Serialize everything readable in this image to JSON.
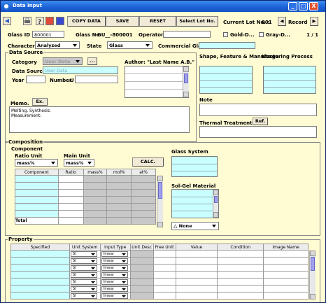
{
  "window": {
    "title": "Data Input",
    "min": "_",
    "max": "□",
    "close": "X"
  },
  "toolbar": {
    "icons": [
      "back-icon",
      "print-icon",
      "help-icon",
      "export-icon",
      "import-icon"
    ],
    "copy_data": "COPY DATA",
    "save": "SAVE",
    "reset": "RESET",
    "select_lot": "Select Lot No.",
    "current_lot_label": "Current Lot No. :",
    "current_lot_value": "001",
    "record_label": "Record",
    "prev": "◀",
    "next": "▶"
  },
  "header": {
    "glass_id_label": "Glass ID",
    "glass_id_value": "800001",
    "glass_no_label": "Glass No",
    "glass_no_value": "GU__-800001",
    "operator_label": "Operator",
    "operator_value": "",
    "gold_label": "Gold-D...",
    "gray_label": "Gray-D...",
    "page": "1 / 1",
    "character_label": "Character",
    "character_value": "Analyzed",
    "state_label": "State",
    "state_value": "Glass",
    "commercial_label": "Commercial Glass"
  },
  "data_source": {
    "group_title": "Data Source",
    "category_label": "Category",
    "category_value": "User Data",
    "more_button": "...",
    "author_label": "Author: \"Last Name A.B.\"",
    "data_source_label": "Data Source",
    "data_source_value": "User Data",
    "year_label": "Year",
    "number_label": "Number",
    "u_label": "U"
  },
  "memo": {
    "label": "Memo.",
    "ex_button": "Ex.",
    "lines": [
      "Melting, Synthesis:",
      "Measurement:"
    ]
  },
  "right_panel": {
    "shape_label": "Shape, Feature & Manufacturing Process",
    "usage_label": "Usage",
    "note_label": "Note",
    "thermal_label": "Thermal Treatment",
    "ref_button": "Ref."
  },
  "composition": {
    "group_title": "Composition",
    "component_title": "Component",
    "ratio_unit_label": "Ratio Unit",
    "ratio_unit_value": "mass%",
    "main_unit_label": "Main Unit",
    "main_unit_value": "mass%",
    "calc_button": "CALC.",
    "columns": [
      "Component",
      "Ratio",
      "mass%",
      "mol%",
      "at%"
    ],
    "total_label": "Total",
    "glass_system_label": "Glass System",
    "solgel_label": "Sol-Gel Material",
    "none_value": "None"
  },
  "property": {
    "group_title": "Property",
    "columns": [
      "Specified",
      "Unit System",
      "Input Type",
      "Unit Desc",
      "Free Unit",
      "Value",
      "Condition",
      "Image Name"
    ],
    "rows": [
      {
        "unit": "SI",
        "input": "linear"
      },
      {
        "unit": "SI",
        "input": "linear"
      },
      {
        "unit": "SI",
        "input": "linear"
      },
      {
        "unit": "SI",
        "input": "linear"
      },
      {
        "unit": "SI",
        "input": "linear"
      },
      {
        "unit": "SI",
        "input": "linear"
      },
      {
        "unit": "SI",
        "input": "linear"
      }
    ]
  },
  "colors": {
    "background": "#fffbd3",
    "cyan_field": "#c9ffff",
    "title_bar": "#1b5fd6"
  }
}
